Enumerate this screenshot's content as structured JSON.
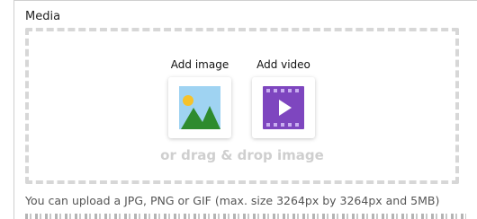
{
  "media": {
    "section_label": "Media",
    "add_image_label": "Add image",
    "add_video_label": "Add video",
    "drag_drop_text": "or drag & drop image",
    "help_text": "You can upload a JPG, PNG or GIF (max. size 3264px by 3264px and 5MB)",
    "icons": {
      "image": "image-icon",
      "video": "video-icon"
    },
    "colors": {
      "dropzone_border": "#d7d7d7",
      "drag_text": "#cfcfcf",
      "image_sky": "#9fd3f2",
      "image_sun": "#f6c22a",
      "image_hills": "#2e8b2e",
      "video_purple": "#7e46bf"
    }
  }
}
